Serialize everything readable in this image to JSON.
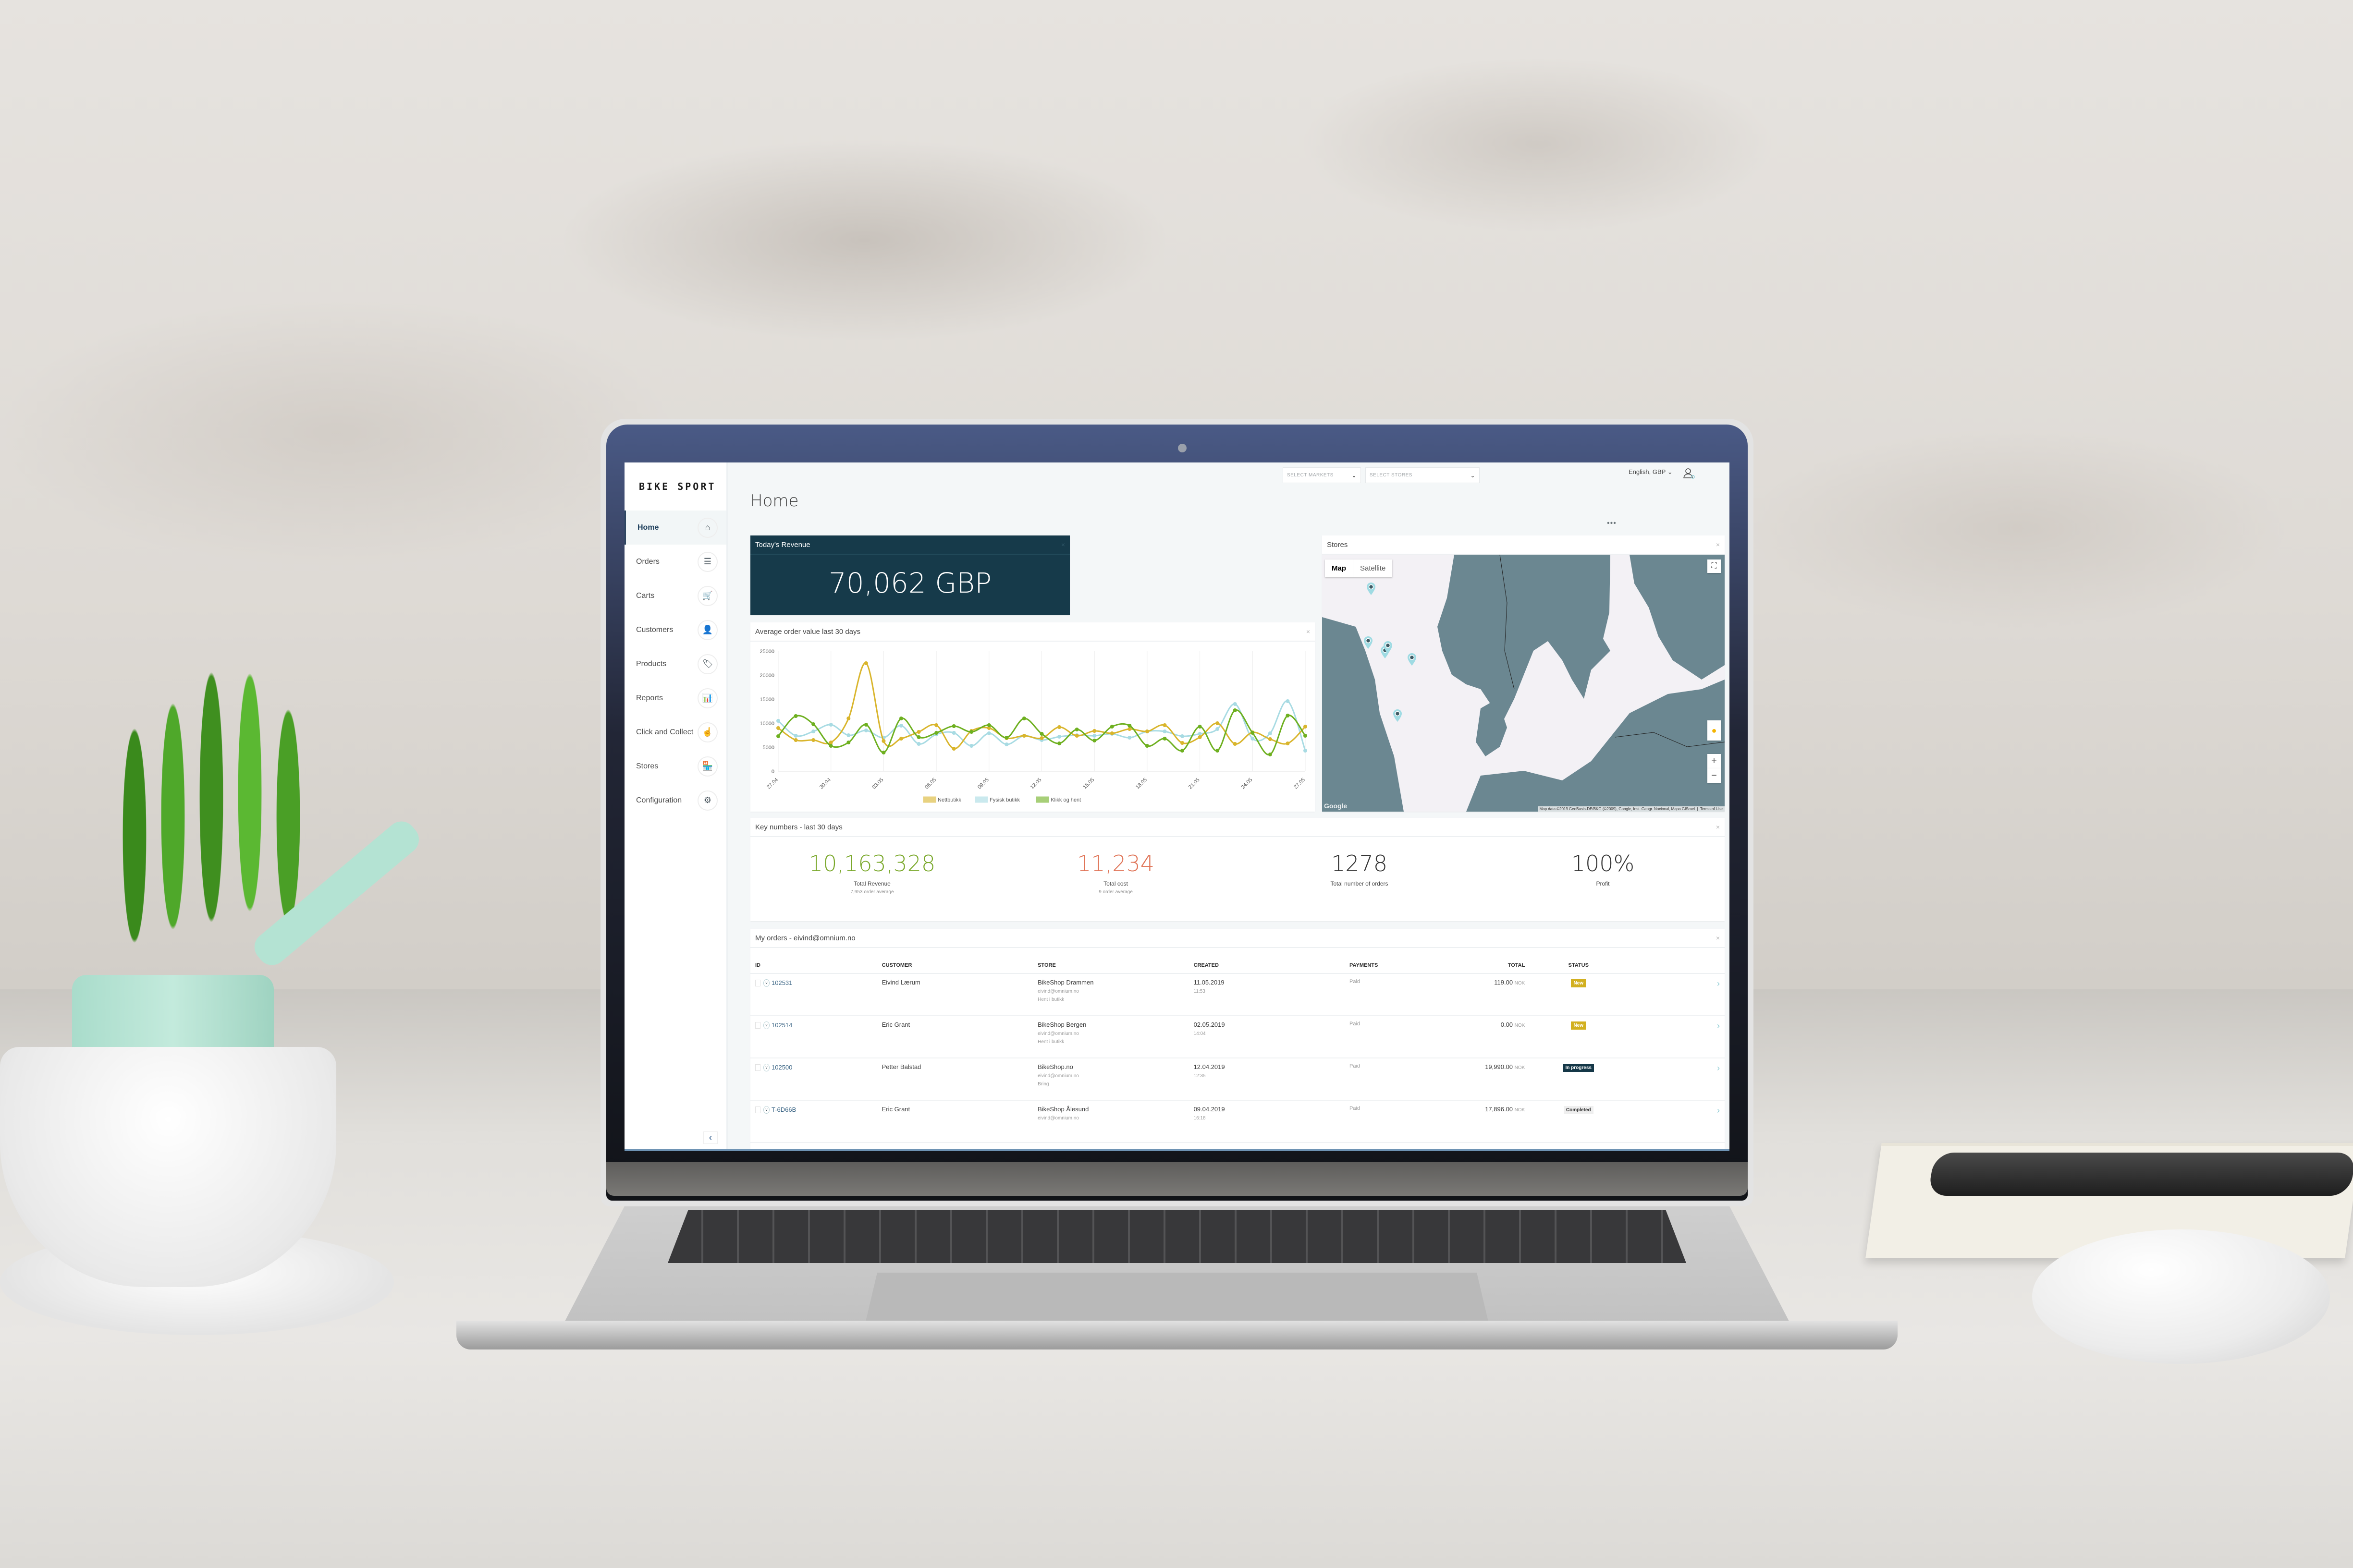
{
  "app": {
    "logo": "BIKE SPORT",
    "page_title": "Home"
  },
  "topbar": {
    "markets_placeholder": "SELECT MARKETS",
    "stores_placeholder": "SELECT STORES",
    "language": "English, GBP",
    "chevron": "⌄",
    "more": "•••"
  },
  "sidebar": {
    "items": [
      {
        "label": "Home",
        "icon": "⌂",
        "active": true
      },
      {
        "label": "Orders",
        "icon": "☰",
        "active": false
      },
      {
        "label": "Carts",
        "icon": "🛒",
        "active": false
      },
      {
        "label": "Customers",
        "icon": "👤",
        "active": false
      },
      {
        "label": "Products",
        "icon": "🏷",
        "active": false
      },
      {
        "label": "Reports",
        "icon": "📊",
        "active": false
      },
      {
        "label": "Click and Collect",
        "icon": "☝",
        "active": false
      },
      {
        "label": "Stores",
        "icon": "🏪",
        "active": false
      },
      {
        "label": "Configuration",
        "icon": "⚙",
        "active": false
      }
    ],
    "collapse": "‹"
  },
  "revenue": {
    "title": "Today's Revenue",
    "value": "70,062 GBP",
    "close": "×"
  },
  "chart_panel": {
    "title": "Average order value last 30 days",
    "close": "×"
  },
  "chart_data": {
    "type": "line",
    "title": "Average order value last 30 days",
    "xlabel": "",
    "ylabel": "",
    "ylim": [
      0,
      25000
    ],
    "yticks": [
      0,
      5000,
      10000,
      15000,
      20000,
      25000
    ],
    "grid": true,
    "legend": "bottom",
    "x": [
      "27.04",
      "28.04",
      "29.04",
      "30.04",
      "01.05",
      "02.05",
      "03.05",
      "04.05",
      "05.05",
      "06.05",
      "07.05",
      "08.05",
      "09.05",
      "10.05",
      "11.05",
      "12.05",
      "13.05",
      "14.05",
      "15.05",
      "16.05",
      "17.05",
      "18.05",
      "19.05",
      "20.05",
      "21.05",
      "22.05",
      "23.05",
      "24.05",
      "25.05",
      "26.05",
      "27.05"
    ],
    "xtick_labels": [
      "27.04",
      "30.04",
      "03.05",
      "06.05",
      "09.05",
      "12.05",
      "15.05",
      "18.05",
      "21.05",
      "24.05",
      "27.05"
    ],
    "series": [
      {
        "name": "Nettbutikk",
        "color": "#d9b52c",
        "values": [
          9000,
          6500,
          6500,
          6000,
          11000,
          22500,
          6300,
          6800,
          8200,
          9600,
          4700,
          8400,
          9000,
          6900,
          7400,
          6900,
          9200,
          7400,
          8400,
          7900,
          8800,
          8300,
          9600,
          5900,
          7100,
          10000,
          5700,
          8100,
          6700,
          5800,
          9300
        ]
      },
      {
        "name": "Fysisk butikk",
        "color": "#a8dbe3",
        "values": [
          10500,
          7400,
          8300,
          9700,
          7500,
          8500,
          7000,
          9500,
          5700,
          7700,
          8000,
          5300,
          7900,
          5600,
          7400,
          6500,
          7200,
          7500,
          7400,
          7800,
          7000,
          8300,
          8300,
          7300,
          7800,
          8800,
          14000,
          6800,
          7900,
          14600,
          4300
        ]
      },
      {
        "name": "Klikk og hent",
        "color": "#6eb020",
        "values": [
          7300,
          11500,
          9800,
          5300,
          6000,
          9700,
          3900,
          11000,
          7100,
          8000,
          9400,
          8200,
          9600,
          7000,
          11000,
          7800,
          5800,
          8700,
          6400,
          9300,
          9500,
          5300,
          6800,
          4300,
          9300,
          4300,
          12700,
          8000,
          3500,
          11600,
          7400
        ]
      }
    ]
  },
  "map_panel": {
    "title": "Stores",
    "close": "×",
    "tabs": [
      {
        "label": "Map",
        "active": true
      },
      {
        "label": "Satellite",
        "active": false
      }
    ],
    "fullscreen": "⛶",
    "zoom_in": "+",
    "zoom_out": "−",
    "pegman": "🧍",
    "google": "Google",
    "attribution": "Map data ©2019 GeoBasis-DE/BKG (©2009), Google, Inst. Geogr. Nacional, Mapa GISrael",
    "terms": "Terms of Use",
    "land_color": "#6b8791",
    "water_color": "#f3f1f5",
    "pin_color": "#9fdbe3"
  },
  "key_numbers": {
    "title": "Key numbers - last 30 days",
    "close": "×",
    "items": [
      {
        "value": "10,163,328",
        "label": "Total Revenue",
        "sub": "7,953 order average",
        "color": "#7aa82b"
      },
      {
        "value": "11,234",
        "label": "Total cost",
        "sub": "9 order average",
        "color": "#e07558"
      },
      {
        "value": "1278",
        "label": "Total number of orders",
        "sub": "",
        "color": "#333333"
      },
      {
        "value": "100%",
        "label": "Profit",
        "sub": "",
        "color": "#333333"
      }
    ]
  },
  "orders": {
    "title": "My orders - eivind@omnium.no",
    "close": "×",
    "columns": [
      "ID",
      "CUSTOMER",
      "STORE",
      "CREATED",
      "PAYMENTS",
      "TOTAL",
      "STATUS"
    ],
    "rows": [
      {
        "id": "102531",
        "customer": "Eivind Lærum",
        "store": "BikeShop Drammen",
        "store_email": "eivind@omnium.no",
        "delivery": "Hent i butikk",
        "created_date": "11.05.2019",
        "created_time": "11:53",
        "payment": "Paid",
        "total": "119.00",
        "currency": "NOK",
        "status": "New",
        "status_type": "new"
      },
      {
        "id": "102514",
        "customer": "Eric Grant",
        "store": "BikeShop Bergen",
        "store_email": "eivind@omnium.no",
        "delivery": "Hent i butikk",
        "created_date": "02.05.2019",
        "created_time": "14:04",
        "payment": "Paid",
        "total": "0.00",
        "currency": "NOK",
        "status": "New",
        "status_type": "new"
      },
      {
        "id": "102500",
        "customer": "Petter Balstad",
        "store": "BikeShop.no",
        "store_email": "eivind@omnium.no",
        "delivery": "Bring",
        "created_date": "12.04.2019",
        "created_time": "12:35",
        "payment": "Paid",
        "total": "19,990.00",
        "currency": "NOK",
        "status": "In progress",
        "status_type": "progress"
      },
      {
        "id": "T-6D66B",
        "customer": "Eric Grant",
        "store": "BikeShop Ålesund",
        "store_email": "eivind@omnium.no",
        "delivery": "",
        "created_date": "09.04.2019",
        "created_time": "16:18",
        "payment": "Paid",
        "total": "17,896.00",
        "currency": "NOK",
        "status": "Completed",
        "status_type": "completed"
      }
    ],
    "row_arrow": "›",
    "expand": "v"
  }
}
